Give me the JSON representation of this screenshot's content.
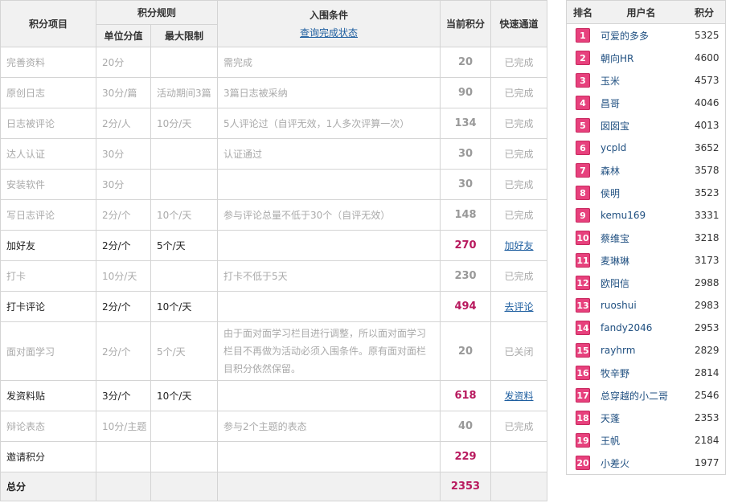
{
  "main_table": {
    "headers": {
      "item": "积分项目",
      "rule_group": "积分规则",
      "unit_value": "单位分值",
      "max_limit": "最大限制",
      "condition": "入围条件",
      "condition_link": "查询完成状态",
      "current_score": "当前积分",
      "quick_access": "快速通道"
    },
    "rows": [
      {
        "item": "完善资料",
        "unit": "20分",
        "limit": "",
        "condition": "需完成",
        "score": "20",
        "action": "已完成",
        "active": false,
        "link": false
      },
      {
        "item": "原创日志",
        "unit": "30分/篇",
        "limit": "活动期间3篇",
        "condition": "3篇日志被采纳",
        "score": "90",
        "action": "已完成",
        "active": false,
        "link": false
      },
      {
        "item": "日志被评论",
        "unit": "2分/人",
        "limit": "10分/天",
        "condition": "5人评论过（自评无效，1人多次评算一次）",
        "score": "134",
        "action": "已完成",
        "active": false,
        "link": false
      },
      {
        "item": "达人认证",
        "unit": "30分",
        "limit": "",
        "condition": "认证通过",
        "score": "30",
        "action": "已完成",
        "active": false,
        "link": false
      },
      {
        "item": "安装软件",
        "unit": "30分",
        "limit": "",
        "condition": "",
        "score": "30",
        "action": "已完成",
        "active": false,
        "link": false
      },
      {
        "item": "写日志评论",
        "unit": "2分/个",
        "limit": "10个/天",
        "condition": "参与评论总量不低于30个（自评无效）",
        "score": "148",
        "action": "已完成",
        "active": false,
        "link": false
      },
      {
        "item": "加好友",
        "unit": "2分/个",
        "limit": "5个/天",
        "condition": "",
        "score": "270",
        "action": "加好友",
        "active": true,
        "link": true
      },
      {
        "item": "打卡",
        "unit": "10分/天",
        "limit": "",
        "condition": "打卡不低于5天",
        "score": "230",
        "action": "已完成",
        "active": false,
        "link": false
      },
      {
        "item": "打卡评论",
        "unit": "2分/个",
        "limit": "10个/天",
        "condition": "",
        "score": "494",
        "action": "去评论",
        "active": true,
        "link": true
      },
      {
        "item": "面对面学习",
        "unit": "2分/个",
        "limit": "5个/天",
        "condition": "由于面对面学习栏目进行调整，所以面对面学习栏目不再做为活动必须入围条件。原有面对面栏目积分依然保留。",
        "score": "20",
        "action": "已关闭",
        "active": false,
        "link": false,
        "tall": true
      },
      {
        "item": "发资料贴",
        "unit": "3分/个",
        "limit": "10个/天",
        "condition": "",
        "score": "618",
        "action": "发资料",
        "active": true,
        "link": true
      },
      {
        "item": "辩论表态",
        "unit": "10分/主题",
        "limit": "",
        "condition": "参与2个主题的表态",
        "score": "40",
        "action": "已完成",
        "active": false,
        "link": false
      },
      {
        "item": "邀请积分",
        "unit": "",
        "limit": "",
        "condition": "",
        "score": "229",
        "action": "",
        "active": true,
        "link": false
      }
    ],
    "total": {
      "label": "总分",
      "score": "2353"
    }
  },
  "ranking": {
    "headers": {
      "rank": "排名",
      "user": "用户名",
      "score": "积分"
    },
    "rows": [
      {
        "rank": "1",
        "user": "可爱的多多",
        "score": "5325"
      },
      {
        "rank": "2",
        "user": "朝向HR",
        "score": "4600"
      },
      {
        "rank": "3",
        "user": "玉米",
        "score": "4573"
      },
      {
        "rank": "4",
        "user": "昌哥",
        "score": "4046"
      },
      {
        "rank": "5",
        "user": "囡囡宝",
        "score": "4013"
      },
      {
        "rank": "6",
        "user": "ycpld",
        "score": "3652"
      },
      {
        "rank": "7",
        "user": "森林",
        "score": "3578"
      },
      {
        "rank": "8",
        "user": "侯明",
        "score": "3523"
      },
      {
        "rank": "9",
        "user": "kemu169",
        "score": "3331"
      },
      {
        "rank": "10",
        "user": "蔡维宝",
        "score": "3218"
      },
      {
        "rank": "11",
        "user": "麦琳琳",
        "score": "3173"
      },
      {
        "rank": "12",
        "user": "欧阳信",
        "score": "2988"
      },
      {
        "rank": "13",
        "user": "ruoshui",
        "score": "2983"
      },
      {
        "rank": "14",
        "user": "fandy2046",
        "score": "2953"
      },
      {
        "rank": "15",
        "user": "rayhrm",
        "score": "2829"
      },
      {
        "rank": "16",
        "user": "牧辛野",
        "score": "2814"
      },
      {
        "rank": "17",
        "user": "总穿越的小二哥",
        "score": "2546"
      },
      {
        "rank": "18",
        "user": "天蓬",
        "score": "2353"
      },
      {
        "rank": "19",
        "user": "王帆",
        "score": "2184"
      },
      {
        "rank": "20",
        "user": "小差火",
        "score": "1977"
      }
    ]
  },
  "colors": {
    "accent_score": "#b8195e",
    "link": "#1f5fa0",
    "rank_badge": "#e7417d",
    "header_bg": "#f1f1f1",
    "border": "#d4d4d4"
  }
}
